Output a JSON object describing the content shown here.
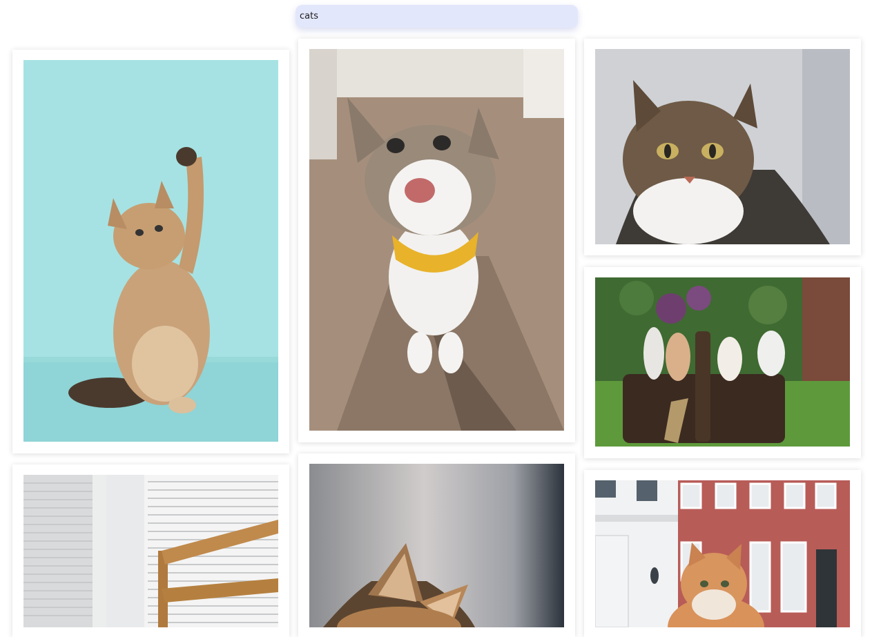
{
  "search": {
    "value": "cats",
    "placeholder": ""
  },
  "gallery": {
    "columns": 3,
    "photos": [
      {
        "subject": "kitten-raising-paw",
        "column": 1,
        "row": 1,
        "background_color": "#9fdfe0"
      },
      {
        "subject": "smiling-cat-yellow-bandana",
        "column": 2,
        "row": 1,
        "background_color": "#a08a78"
      },
      {
        "subject": "tabby-cat-portrait",
        "column": 3,
        "row": 1,
        "background_color": "#c9cbd0"
      },
      {
        "subject": "kittens-in-basket",
        "column": 3,
        "row": 2,
        "background_color": "#4f7a3a"
      },
      {
        "subject": "window-blinds-cat",
        "column": 1,
        "row": 2,
        "background_color": "#e6e7e8"
      },
      {
        "subject": "cat-ears-closeup",
        "column": 2,
        "row": 2,
        "background_color": "#b9b6b4"
      },
      {
        "subject": "orange-cat-street",
        "column": 3,
        "row": 3,
        "background_color": "#e8eaed"
      }
    ]
  },
  "colors": {
    "search_background": "#e3e7fb",
    "card_background": "#ffffff"
  }
}
